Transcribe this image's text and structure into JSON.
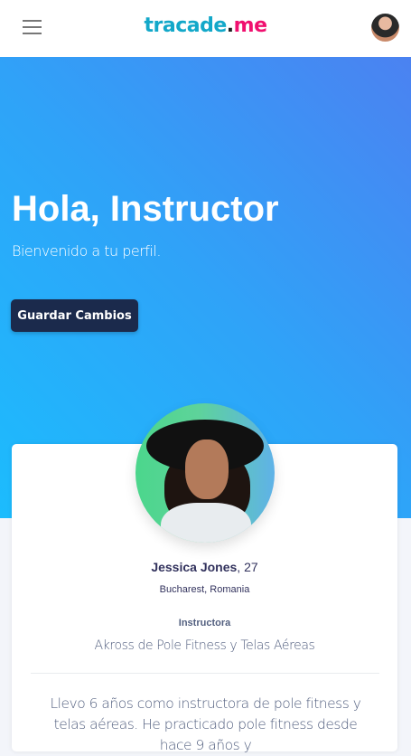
{
  "header": {
    "logo": {
      "part1": "tracade",
      "dot": ".",
      "part2": "me"
    },
    "menu_icon": "hamburger-icon",
    "user_avatar": "user-avatar"
  },
  "hero": {
    "title": "Hola, Instructor",
    "subtitle": "Bienvenido a tu perfil.",
    "save_label": "Guardar Cambios"
  },
  "profile": {
    "name": "Jessica Jones",
    "age": ", 27",
    "location": "Bucharest, Romania",
    "role": "Instructora",
    "studio": "Akross de Pole Fitness y Telas Aéreas",
    "bio": "Llevo 6 años como instructora de pole fitness y telas aéreas. He practicado pole fitness desde hace 9 años y"
  },
  "colors": {
    "brand_teal": "#13a8c9",
    "brand_pink": "#f0106f",
    "button": "#1b2a4c",
    "hero_start": "#1cbcfd",
    "hero_end": "#4b82f1"
  }
}
